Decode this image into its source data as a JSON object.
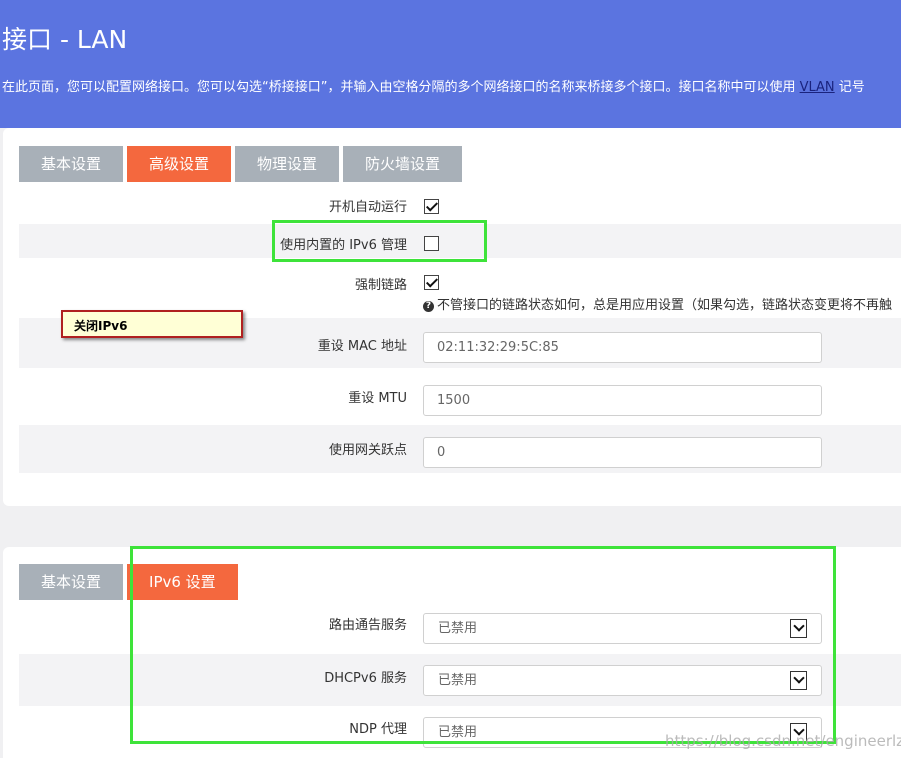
{
  "header": {
    "title": "接口 - LAN",
    "description_prefix": "在此页面，您可以配置网络接口。您可以勾选“桥接接口”，并输入由空格分隔的多个网络接口的名称来桥接多个接口。接口名称中可以使用 ",
    "vlan_link": "VLAN",
    "description_suffix": " 记号"
  },
  "general_tabs": [
    "基本设置",
    "高级设置",
    "物理设置",
    "防火墙设置"
  ],
  "advanced": {
    "auto_start": {
      "label": "开机自动运行",
      "checked": true
    },
    "builtin_ipv6": {
      "label": "使用内置的 IPv6 管理",
      "checked": false
    },
    "force_link": {
      "label": "强制链路",
      "checked": true,
      "help": "不管接口的链路状态如何，总是用应用设置（如果勾选，链路状态变更将不再触"
    },
    "mac": {
      "label": "重设 MAC 地址",
      "value": "02:11:32:29:5C:85"
    },
    "mtu": {
      "label": "重设 MTU",
      "value": "1500"
    },
    "metric": {
      "label": "使用网关跃点",
      "value": "0"
    }
  },
  "annotation": "关闭IPv6",
  "dhcp_tabs": [
    "基本设置",
    "IPv6 设置"
  ],
  "ipv6": {
    "ra": {
      "label": "路由通告服务",
      "value": "已禁用"
    },
    "dhcpv6": {
      "label": "DHCPv6 服务",
      "value": "已禁用"
    },
    "ndp": {
      "label": "NDP 代理",
      "value": "已禁用"
    }
  },
  "watermark": "https://blog.csdn.net/engineerlzk",
  "colors": {
    "header_bg": "#5b74e0",
    "tab_active": "#f4683e",
    "tab_inactive": "#a8b0b8",
    "highlight": "#3ee33a"
  }
}
